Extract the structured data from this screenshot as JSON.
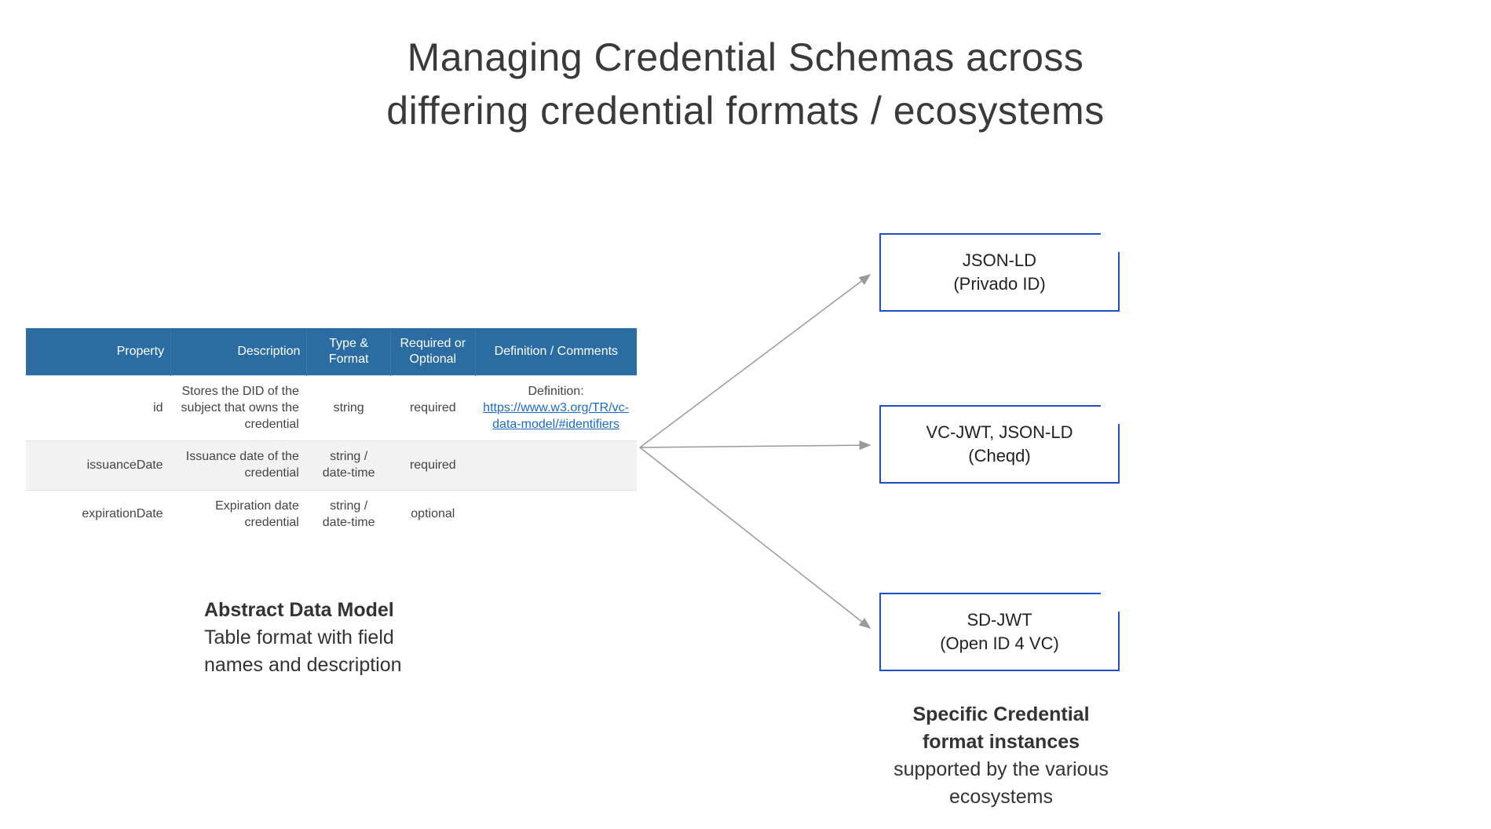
{
  "title_line1": "Managing Credential Schemas across",
  "title_line2": "differing credential formats  / ecosystems",
  "table": {
    "headers": {
      "property": "Property",
      "description": "Description",
      "type": "Type & Format",
      "required": "Required or Optional",
      "definition": "Definition / Comments"
    },
    "rows": [
      {
        "property": "id",
        "description": "Stores the DID of the subject that owns the credential",
        "type": "string",
        "required": "required",
        "definition_prefix": "Definition:",
        "definition_link": "https://www.w3.org/TR/vc-data-model/#identifiers"
      },
      {
        "property": "issuanceDate",
        "description": "Issuance date of the credential",
        "type": "string / date-time",
        "required": "required",
        "definition_prefix": "",
        "definition_link": ""
      },
      {
        "property": "expirationDate",
        "description": "Expiration date credential",
        "type": "string / date-time",
        "required": "optional",
        "definition_prefix": "",
        "definition_link": ""
      }
    ]
  },
  "table_caption": {
    "bold": "Abstract Data Model",
    "line2": "Table format with field",
    "line3": "names and description"
  },
  "format_boxes": [
    {
      "line1": "JSON-LD",
      "line2": "(Privado ID)"
    },
    {
      "line1": "VC-JWT, JSON-LD",
      "line2": "(Cheqd)"
    },
    {
      "line1": "SD-JWT",
      "line2": "(Open ID 4 VC)"
    }
  ],
  "right_caption": {
    "bold1": "Specific Credential",
    "bold2": "format instances",
    "line3": "supported by the various",
    "line4": "ecosystems"
  }
}
